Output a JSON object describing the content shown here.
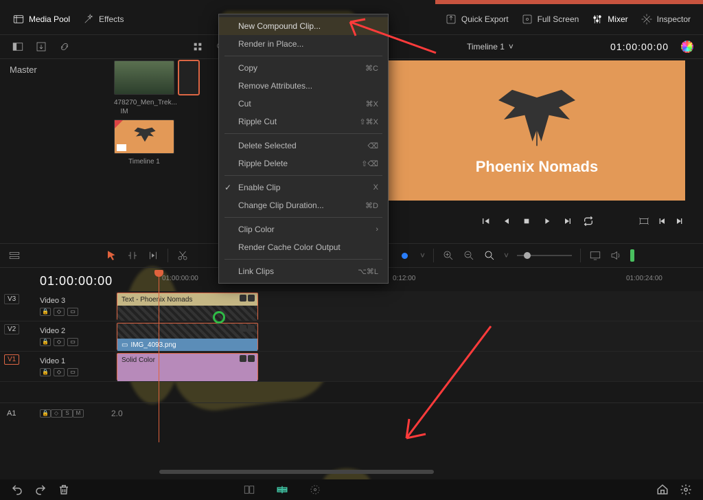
{
  "topbar": {
    "media_pool": "Media Pool",
    "effects": "Effects",
    "quick_export": "Quick Export",
    "full_screen": "Full Screen",
    "mixer": "Mixer",
    "inspector": "Inspector"
  },
  "subbar": {
    "timeline_title": "Timeline 1",
    "timecode": "01:00:00:00"
  },
  "mediapool": {
    "master": "Master"
  },
  "thumbs": {
    "clip1": "478270_Men_Trek...",
    "clip2": "IM",
    "timeline": "Timeline 1"
  },
  "viewer": {
    "brand": "Phoenix Nomads"
  },
  "ctx": {
    "items": [
      {
        "label": "New Compound Clip...",
        "shortcut": ""
      },
      {
        "label": "Render in Place...",
        "shortcut": ""
      },
      {
        "__sep": true
      },
      {
        "label": "Copy",
        "shortcut": "⌘C"
      },
      {
        "label": "Remove Attributes...",
        "shortcut": ""
      },
      {
        "label": "Cut",
        "shortcut": "⌘X"
      },
      {
        "label": "Ripple Cut",
        "shortcut": "⇧⌘X"
      },
      {
        "__sep": true
      },
      {
        "label": "Delete Selected",
        "shortcut": "⌫"
      },
      {
        "label": "Ripple Delete",
        "shortcut": "⇧⌫"
      },
      {
        "__sep": true
      },
      {
        "label": "Enable Clip",
        "shortcut": "X",
        "checked": true
      },
      {
        "label": "Change Clip Duration...",
        "shortcut": "⌘D"
      },
      {
        "__sep": true
      },
      {
        "label": "Clip Color",
        "shortcut": "›"
      },
      {
        "label": "Render Cache Color Output",
        "shortcut": ""
      },
      {
        "__sep": true
      },
      {
        "label": "Link Clips",
        "shortcut": "⌥⌘L"
      }
    ]
  },
  "timeline": {
    "timecode": "01:00:00:00",
    "ruler": [
      "01:00:00:00",
      "0:12:00",
      "01:00:24:00"
    ],
    "tracks": {
      "v3": {
        "tag": "V3",
        "name": "Video 3",
        "clip": "Text - Phoenix Nomads"
      },
      "v2": {
        "tag": "V2",
        "name": "Video 2",
        "clip": "IMG_4093.png"
      },
      "v1": {
        "tag": "V1",
        "name": "Video 1",
        "clip": "Solid Color"
      },
      "a1": {
        "tag": "A1",
        "val": "2.0"
      }
    },
    "mini_icons": {
      "lock": "🔒",
      "auto": "◇",
      "disp": "▭",
      "s": "S",
      "m": "M"
    }
  },
  "colors": {
    "accent": "#e0623d",
    "select": "#d64",
    "green": "#2fbb46"
  }
}
